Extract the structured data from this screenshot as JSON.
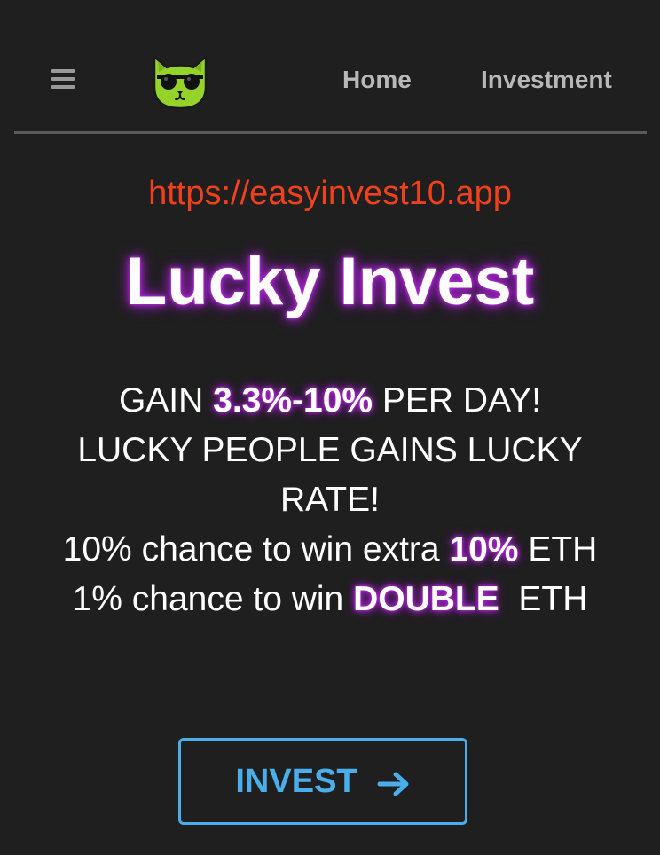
{
  "header": {
    "nav": {
      "home_label": "Home",
      "investment_label": "Investment"
    },
    "menu_icon": "hamburger-menu-icon",
    "logo_icon": "cat-with-sunglasses-logo"
  },
  "main": {
    "url": "https://easyinvest10.app",
    "title": "Lucky Invest",
    "line1": {
      "pre": "GAIN ",
      "hl": "3.3%-10%",
      "post": " PER DAY!"
    },
    "line2": "LUCKY PEOPLE GAINS LUCKY",
    "line3": "RATE!",
    "line4": {
      "pre": "10% chance to win extra ",
      "hl": "10%",
      "post": " ETH"
    },
    "line5": {
      "pre": "1% chance to win ",
      "hl": "DOUBLE",
      "post": "  ETH"
    },
    "invest_button": {
      "label": "INVEST",
      "icon": "arrow-right-icon"
    }
  },
  "colors": {
    "background": "#1f1f1f",
    "url": "#f0401c",
    "glow": "#a020c8",
    "button": "#4aaeea",
    "nav_text": "#b8b8b8"
  }
}
